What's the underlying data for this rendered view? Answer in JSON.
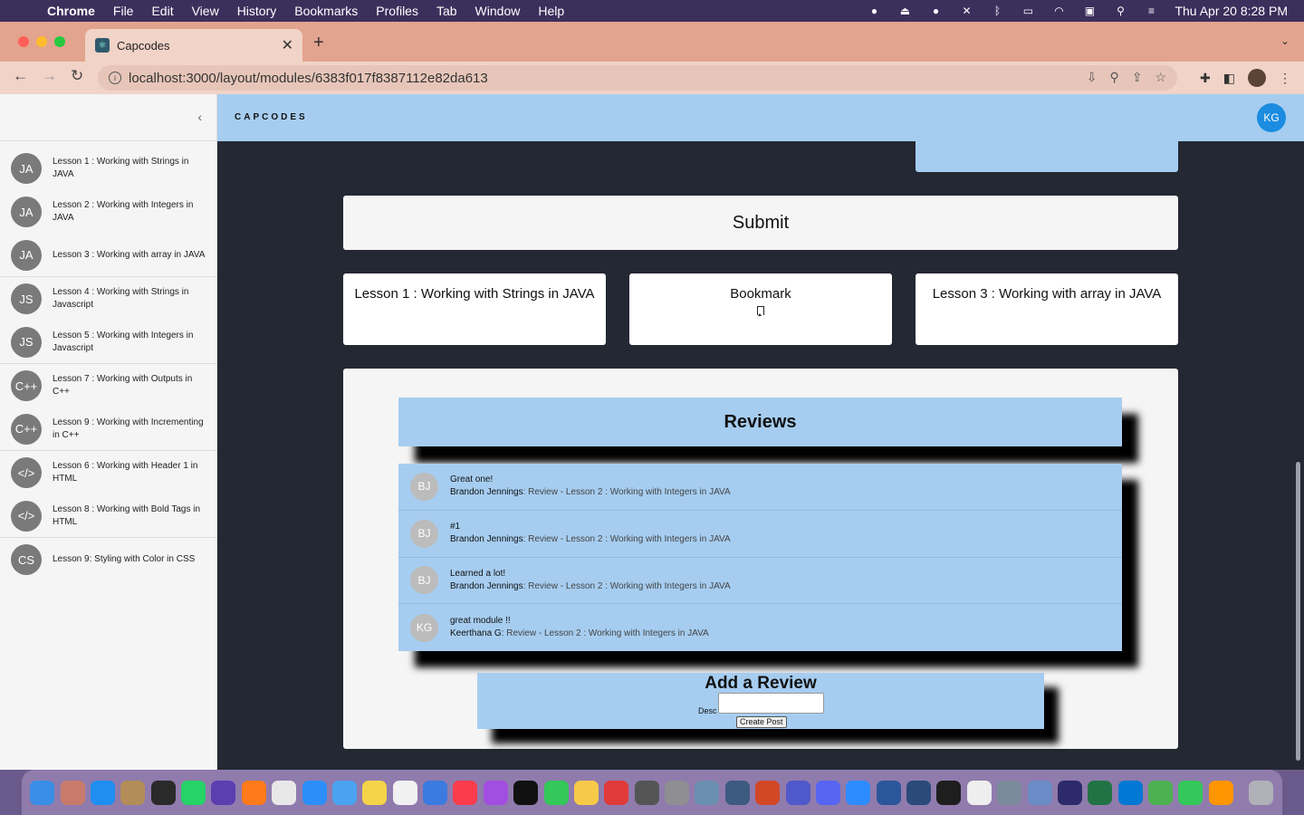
{
  "menubar": {
    "app": "Chrome",
    "items": [
      "File",
      "Edit",
      "View",
      "History",
      "Bookmarks",
      "Profiles",
      "Tab",
      "Window",
      "Help"
    ],
    "clock": "Thu Apr 20  8:28 PM"
  },
  "browser": {
    "tab_title": "Capcodes",
    "url": "localhost:3000/layout/modules/6383f017f8387112e82da613"
  },
  "app": {
    "brand": "CAPCODES",
    "user_initials": "KG"
  },
  "sidebar": {
    "lessons": [
      {
        "initials": "JA",
        "title": "Lesson 1 : Working with Strings in JAVA"
      },
      {
        "initials": "JA",
        "title": "Lesson 2 : Working with Integers in JAVA"
      },
      {
        "initials": "JA",
        "title": "Lesson 3 : Working with array in JAVA"
      },
      {
        "initials": "JS",
        "title": "Lesson 4 : Working with Strings in Javascript"
      },
      {
        "initials": "JS",
        "title": "Lesson 5 : Working with Integers in Javascript"
      },
      {
        "initials": "C++",
        "title": "Lesson 7 : Working with Outputs in C++"
      },
      {
        "initials": "C++",
        "title": "Lesson 9 : Working with Incrementing in C++"
      },
      {
        "initials": "</>",
        "title": "Lesson 6 : Working with Header 1 in HTML"
      },
      {
        "initials": "</>",
        "title": "Lesson 8 : Working with Bold Tags in HTML"
      },
      {
        "initials": "CS",
        "title": "Lesson 9: Styling with Color in CSS"
      }
    ]
  },
  "main": {
    "submit_label": "Submit",
    "prev_lesson": "Lesson 1 : Working with Strings in JAVA",
    "bookmark_label": "Bookmark",
    "next_lesson": "Lesson 3 : Working with array in JAVA",
    "reviews_title": "Reviews",
    "reviews": [
      {
        "initials": "BJ",
        "text": "Great one!",
        "author": "Brandon Jennings",
        "meta": ": Review - Lesson 2 : Working with Integers in JAVA"
      },
      {
        "initials": "BJ",
        "text": "#1",
        "author": "Brandon Jennings",
        "meta": ": Review - Lesson 2 : Working with Integers in JAVA"
      },
      {
        "initials": "BJ",
        "text": "Learned a lot!",
        "author": "Brandon Jennings",
        "meta": ": Review - Lesson 2 : Working with Integers in JAVA"
      },
      {
        "initials": "KG",
        "text": "great module !!",
        "author": "Keerthana G",
        "meta": ": Review - Lesson 2 : Working with Integers in JAVA"
      }
    ],
    "add_review_title": "Add a Review",
    "desc_label": "Desc",
    "desc_value": "",
    "create_post_label": "Create Post"
  },
  "colors": {
    "header_bg": "#a6cdf0",
    "main_bg": "#242833",
    "accent": "#1b8ce0"
  }
}
